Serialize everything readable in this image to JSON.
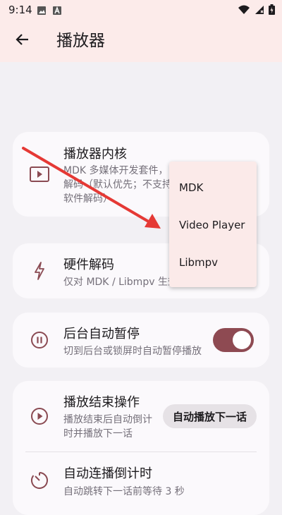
{
  "status": {
    "time": "9:14"
  },
  "appbar": {
    "title": "播放器"
  },
  "settings": {
    "player_core": {
      "title": "播放器内核",
      "subtitle": "MDK 多媒体开发套件，\n解码（默认优先；不支持\n软件解码）"
    },
    "hw_decode": {
      "title": "硬件解码",
      "subtitle": "仅对 MDK / Libmpv 生效"
    },
    "bg_pause": {
      "title": "后台自动暂停",
      "subtitle": "切到后台或锁屏时自动暂停播放",
      "enabled": true
    },
    "end_action": {
      "title": "播放结束操作",
      "subtitle": "播放结束后自动倒计\n时并播放下一话",
      "button_label": "自动播放下一话"
    },
    "countdown": {
      "title": "自动连播倒计时",
      "subtitle": "自动跳转下一话前等待 3 秒"
    }
  },
  "dropdown": {
    "options": [
      "MDK",
      "Video Player",
      "Libmpv"
    ]
  },
  "colors": {
    "accent": "#8e4a52",
    "arrow": "#e53935",
    "appbar": "#fcebea"
  }
}
